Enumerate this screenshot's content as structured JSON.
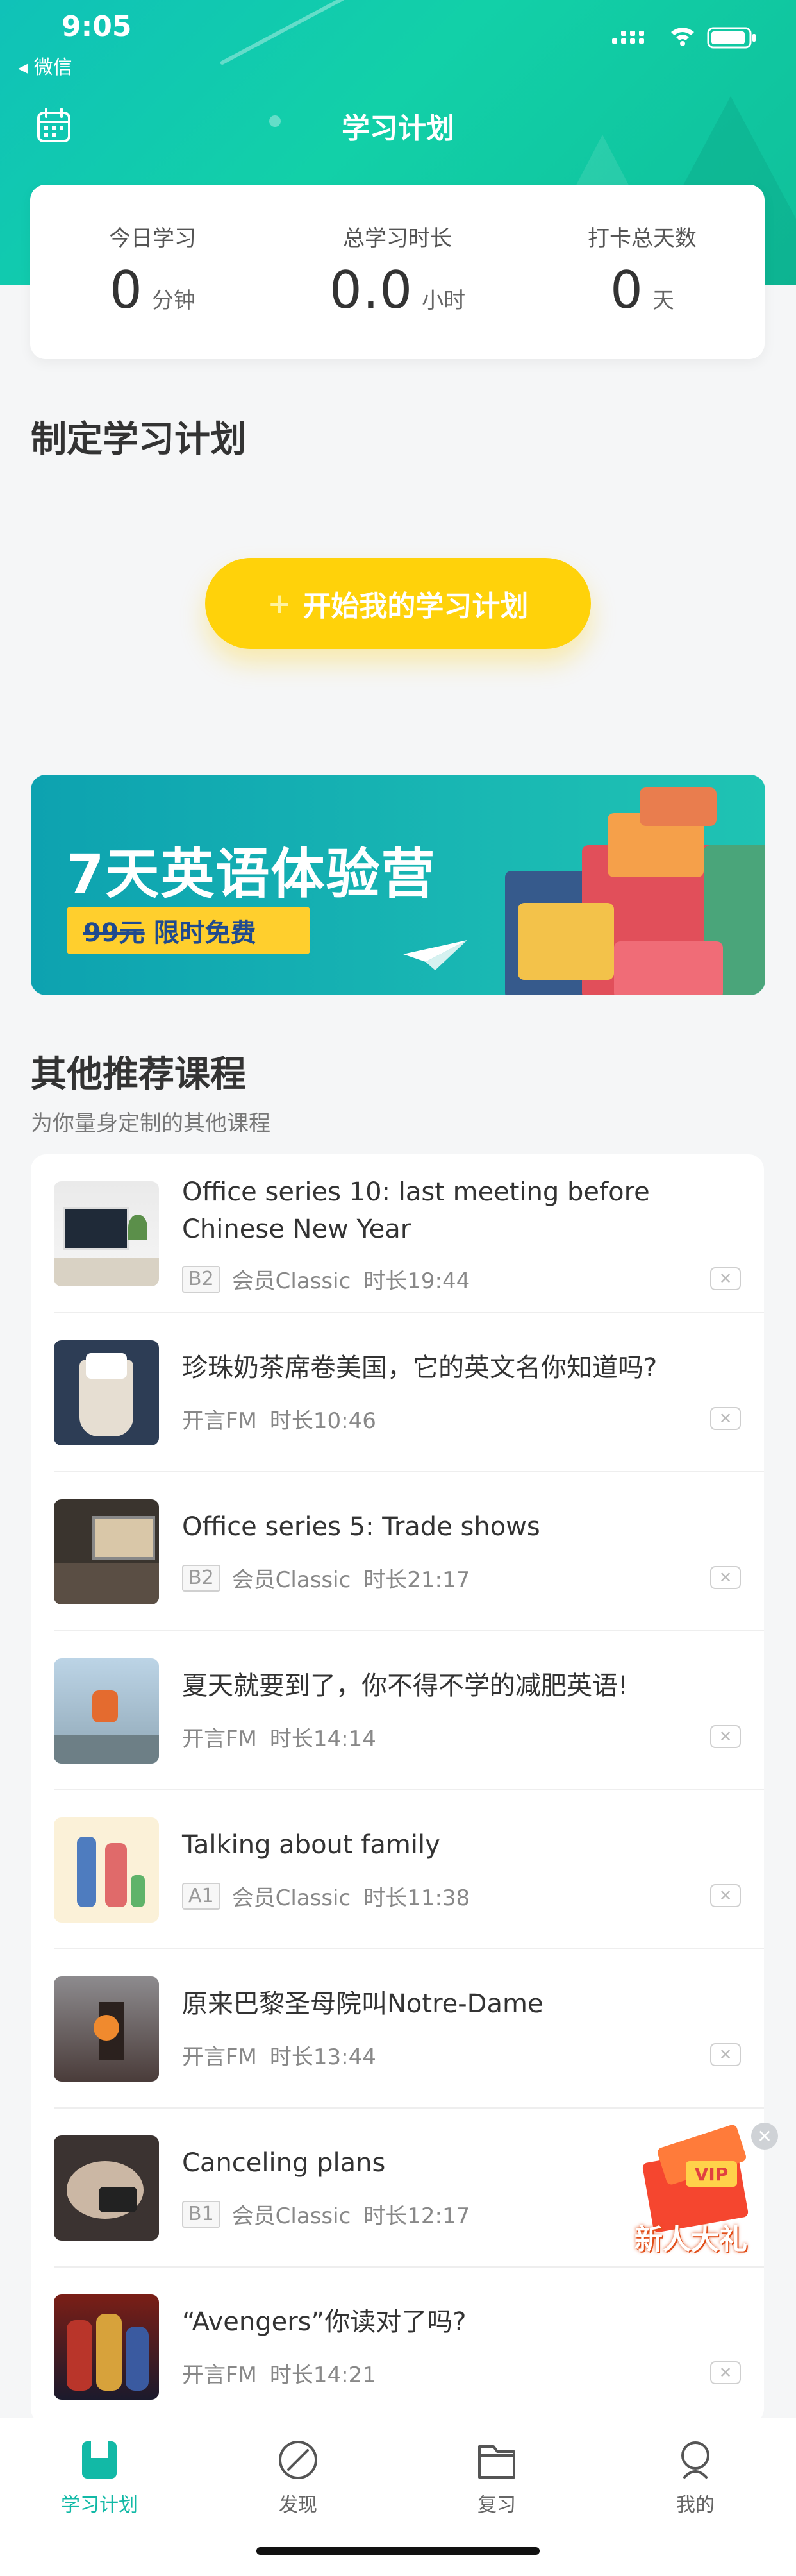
{
  "status_bar": {
    "time": "9:05",
    "back_label": "◂ 微信"
  },
  "header": {
    "title": "学习计划"
  },
  "stats": [
    {
      "label": "今日学习",
      "value": "0",
      "unit": "分钟"
    },
    {
      "label": "总学习时长",
      "value": "0.0",
      "unit": "小时"
    },
    {
      "label": "打卡总天数",
      "value": "0",
      "unit": "天"
    }
  ],
  "plan": {
    "heading": "制定学习计划",
    "button_plus": "+",
    "button_label": "开始我的学习计划"
  },
  "banner": {
    "title": "7天英语体验营",
    "old_price": "99元",
    "free_label": "限时免费"
  },
  "recommend": {
    "title": "其他推荐课程",
    "subtitle": "为你量身定制的其他课程",
    "courses": [
      {
        "title_line1": "Office series 10: last meeting before",
        "title_line2": "Chinese New Year",
        "level": "B2",
        "source": "会员Classic",
        "duration": "时长19:44"
      },
      {
        "title_line1": "珍珠奶茶席卷美国，它的英文名你知道吗?",
        "title_line2": "",
        "level": "",
        "source": "开言FM",
        "duration": "时长10:46"
      },
      {
        "title_line1": "Office series 5: Trade shows",
        "title_line2": "",
        "level": "B2",
        "source": "会员Classic",
        "duration": "时长21:17"
      },
      {
        "title_line1": "夏天就要到了，你不得不学的减肥英语!",
        "title_line2": "",
        "level": "",
        "source": "开言FM",
        "duration": "时长14:14"
      },
      {
        "title_line1": "Talking about family",
        "title_line2": "",
        "level": "A1",
        "source": "会员Classic",
        "duration": "时长11:38"
      },
      {
        "title_line1": "原来巴黎圣母院叫Notre-Dame",
        "title_line2": "",
        "level": "",
        "source": "开言FM",
        "duration": "时长13:44"
      },
      {
        "title_line1": "Canceling plans",
        "title_line2": "",
        "level": "B1",
        "source": "会员Classic",
        "duration": "时长12:17"
      },
      {
        "title_line1": "“Avengers”你读对了吗?",
        "title_line2": "",
        "level": "",
        "source": "开言FM",
        "duration": "时长14:21"
      }
    ]
  },
  "gift": {
    "badge": "VIP",
    "label": "新人大礼"
  },
  "tabs": [
    {
      "label": "学习计划",
      "icon": "study-plan-icon",
      "active": true
    },
    {
      "label": "发现",
      "icon": "compass-icon",
      "active": false
    },
    {
      "label": "复习",
      "icon": "folder-icon",
      "active": false
    },
    {
      "label": "我的",
      "icon": "user-icon",
      "active": false
    }
  ],
  "colors": {
    "accent": "#12b9a6",
    "button": "#ffd20a",
    "banner": "#19b7b3"
  }
}
